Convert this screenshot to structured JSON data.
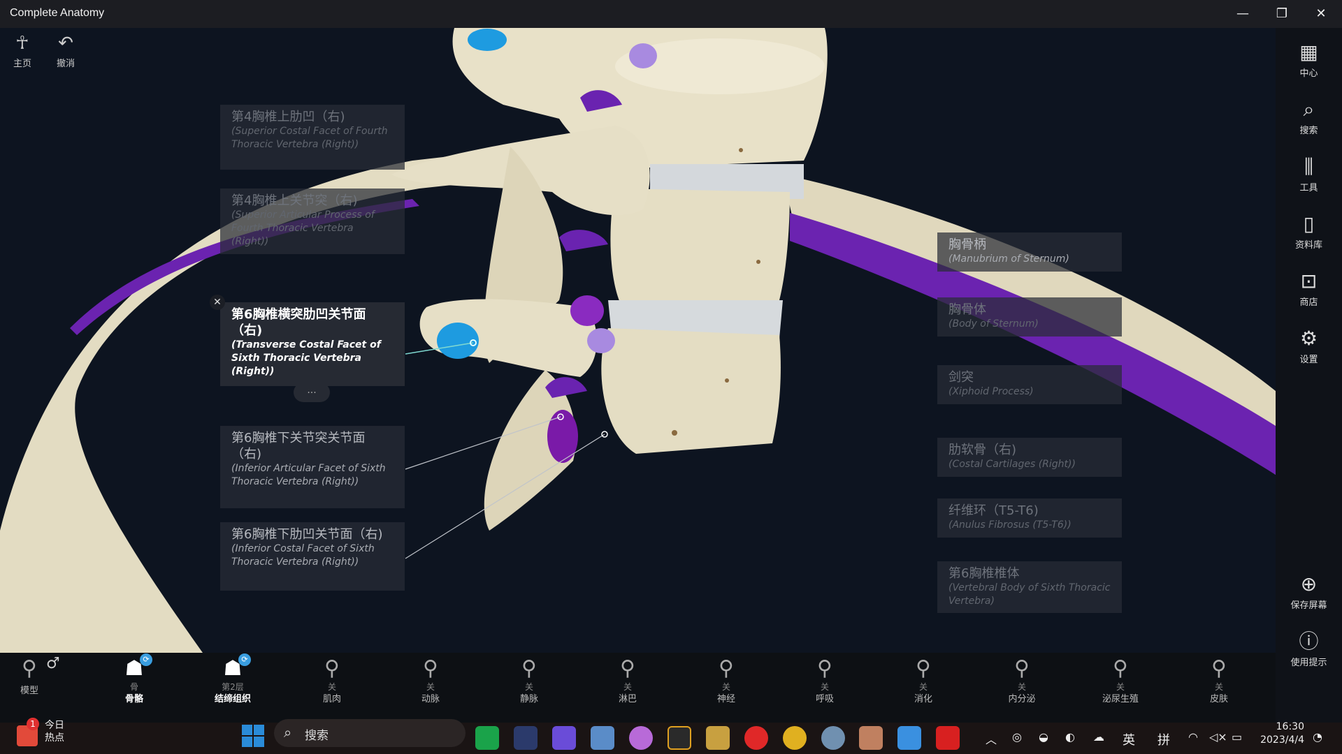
{
  "app": {
    "title": "Complete Anatomy",
    "window_controls": [
      "—",
      "❐",
      "✕"
    ]
  },
  "top_tools": [
    {
      "icon": "person-icon",
      "label": "主页"
    },
    {
      "icon": "undo-icon",
      "label": "撤消"
    }
  ],
  "right_toolbar": [
    {
      "icon": "layout-icon",
      "label": "中心"
    },
    {
      "icon": "search-icon",
      "label": "搜索"
    },
    {
      "icon": "tools-icon",
      "label": "工具"
    },
    {
      "icon": "library-icon",
      "label": "资料库"
    },
    {
      "icon": "shop-icon",
      "label": "商店"
    },
    {
      "icon": "gear-icon",
      "label": "设置"
    },
    {
      "icon": "plus-circle-icon",
      "label": "保存屏幕"
    },
    {
      "icon": "help-icon",
      "label": "使用提示"
    }
  ],
  "labels_left": [
    {
      "zh": "第4胸椎上肋凹（右)",
      "en": "(Superior Costal Facet of Fourth Thoracic Vertebra (Right))",
      "state": "dim"
    },
    {
      "zh": "第4胸椎上关节突（右)",
      "en": "(Superior Articular Process of Fourth Thoracic Vertebra (Right))",
      "state": "dim"
    },
    {
      "zh": "第6胸椎横突肋凹关节面（右)",
      "en": "(Transverse Costal Facet of Sixth Thoracic Vertebra (Right))",
      "state": "active"
    },
    {
      "zh": "第6胸椎下关节突关节面（右)",
      "en": "(Inferior Articular Facet of Sixth Thoracic Vertebra (Right))",
      "state": "mid"
    },
    {
      "zh": "第6胸椎下肋凹关节面（右)",
      "en": "(Inferior Costal Facet of Sixth Thoracic Vertebra (Right))",
      "state": "mid"
    }
  ],
  "labels_right": [
    {
      "zh": "胸骨柄",
      "en": "(Manubrium of Sternum)",
      "state": "mid"
    },
    {
      "zh": "胸骨体",
      "en": "(Body of Sternum)",
      "state": "dim"
    },
    {
      "zh": "剑突",
      "en": "(Xiphoid Process)",
      "state": "dim"
    },
    {
      "zh": "肋软骨（右)",
      "en": "(Costal Cartilages (Right))",
      "state": "dim"
    },
    {
      "zh": "纤维环（T5-T6)",
      "en": "(Anulus Fibrosus (T5-T6))",
      "state": "dim"
    },
    {
      "zh": "第6胸椎椎体",
      "en": "(Vertebral Body of Sixth Thoracic Vertebra)",
      "state": "dim"
    }
  ],
  "label_controls": {
    "close": "✕",
    "more": "..."
  },
  "bottom_layers": {
    "model": {
      "label": "模型",
      "icon": "model-figure-icon",
      "gender_icon": "male-symbol-icon"
    },
    "items": [
      {
        "label": "骨骼",
        "sub": "骨",
        "active": true,
        "badge": "⟳"
      },
      {
        "label": "结缔组织",
        "sub": "第2层",
        "active": true,
        "badge": "⟳"
      },
      {
        "label": "肌肉",
        "sub": "关",
        "active": false
      },
      {
        "label": "动脉",
        "sub": "关",
        "active": false
      },
      {
        "label": "静脉",
        "sub": "关",
        "active": false
      },
      {
        "label": "淋巴",
        "sub": "关",
        "active": false
      },
      {
        "label": "神经",
        "sub": "关",
        "active": false
      },
      {
        "label": "呼吸",
        "sub": "关",
        "active": false
      },
      {
        "label": "消化",
        "sub": "关",
        "active": false
      },
      {
        "label": "内分泌",
        "sub": "关",
        "active": false
      },
      {
        "label": "泌尿生殖",
        "sub": "关",
        "active": false
      },
      {
        "label": "皮肤",
        "sub": "关",
        "active": false
      }
    ]
  },
  "taskbar": {
    "news": {
      "line1": "今日",
      "line2": "热点",
      "badge": "1"
    },
    "search_placeholder": "搜索",
    "apps": [
      {
        "name": "windows-start-icon",
        "color": "#2a8bd8"
      },
      {
        "name": "green-app-icon",
        "color": "#1aa34a"
      },
      {
        "name": "steam-like-icon",
        "color": "#2b3a6b"
      },
      {
        "name": "crystal-icon",
        "color": "#6a4cd8"
      },
      {
        "name": "puzzle-icon",
        "color": "#5a8cc8"
      },
      {
        "name": "sphere-icon",
        "color": "#b86ad8"
      },
      {
        "name": "g-app-icon",
        "color": "#e0a020"
      },
      {
        "name": "league-icon",
        "color": "#c8a040"
      },
      {
        "name": "netease-music-icon",
        "color": "#e02828"
      },
      {
        "name": "chrome-icon",
        "color": "#e0b020"
      },
      {
        "name": "settings-app-icon",
        "color": "#7090b0"
      },
      {
        "name": "complete-anatomy-icon",
        "color": "#c08060"
      },
      {
        "name": "paint-icon",
        "color": "#3a90e0"
      },
      {
        "name": "acrobat-icon",
        "color": "#d82020"
      }
    ],
    "tray": {
      "ime_lang": "英",
      "ime_mode": "拼",
      "time": "16:30",
      "date": "2023/4/4"
    }
  },
  "colors": {
    "bone": "#e6dfc6",
    "purple_facet": "#7a2bc0",
    "blue_facet": "#1e9be0",
    "background": "#0d1420"
  }
}
